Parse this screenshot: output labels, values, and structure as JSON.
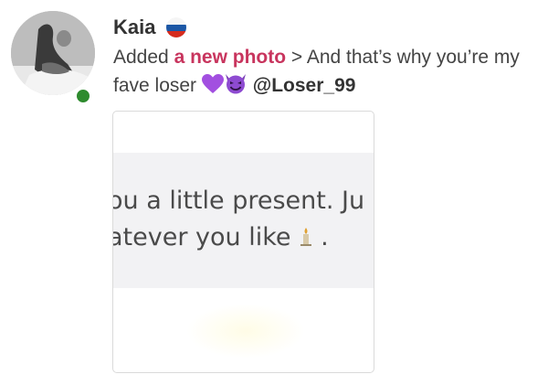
{
  "post": {
    "username": "Kaia",
    "flag_icon": "russia-flag-icon",
    "text_prefix": "Added ",
    "link_text": "a new photo",
    "text_middle": " > And that’s why you’re my fave loser ",
    "emoji_1": "purple-heart-icon",
    "emoji_2": "smiling-devil-icon",
    "mention": "@Loser_99",
    "online_status_color": "#2e8b2e",
    "link_color": "#c8355e"
  },
  "photo": {
    "line_1": "ou a little present. Ju",
    "line_2": "atever you like",
    "line_2_suffix": " .",
    "inline_icon": "candle-icon"
  }
}
